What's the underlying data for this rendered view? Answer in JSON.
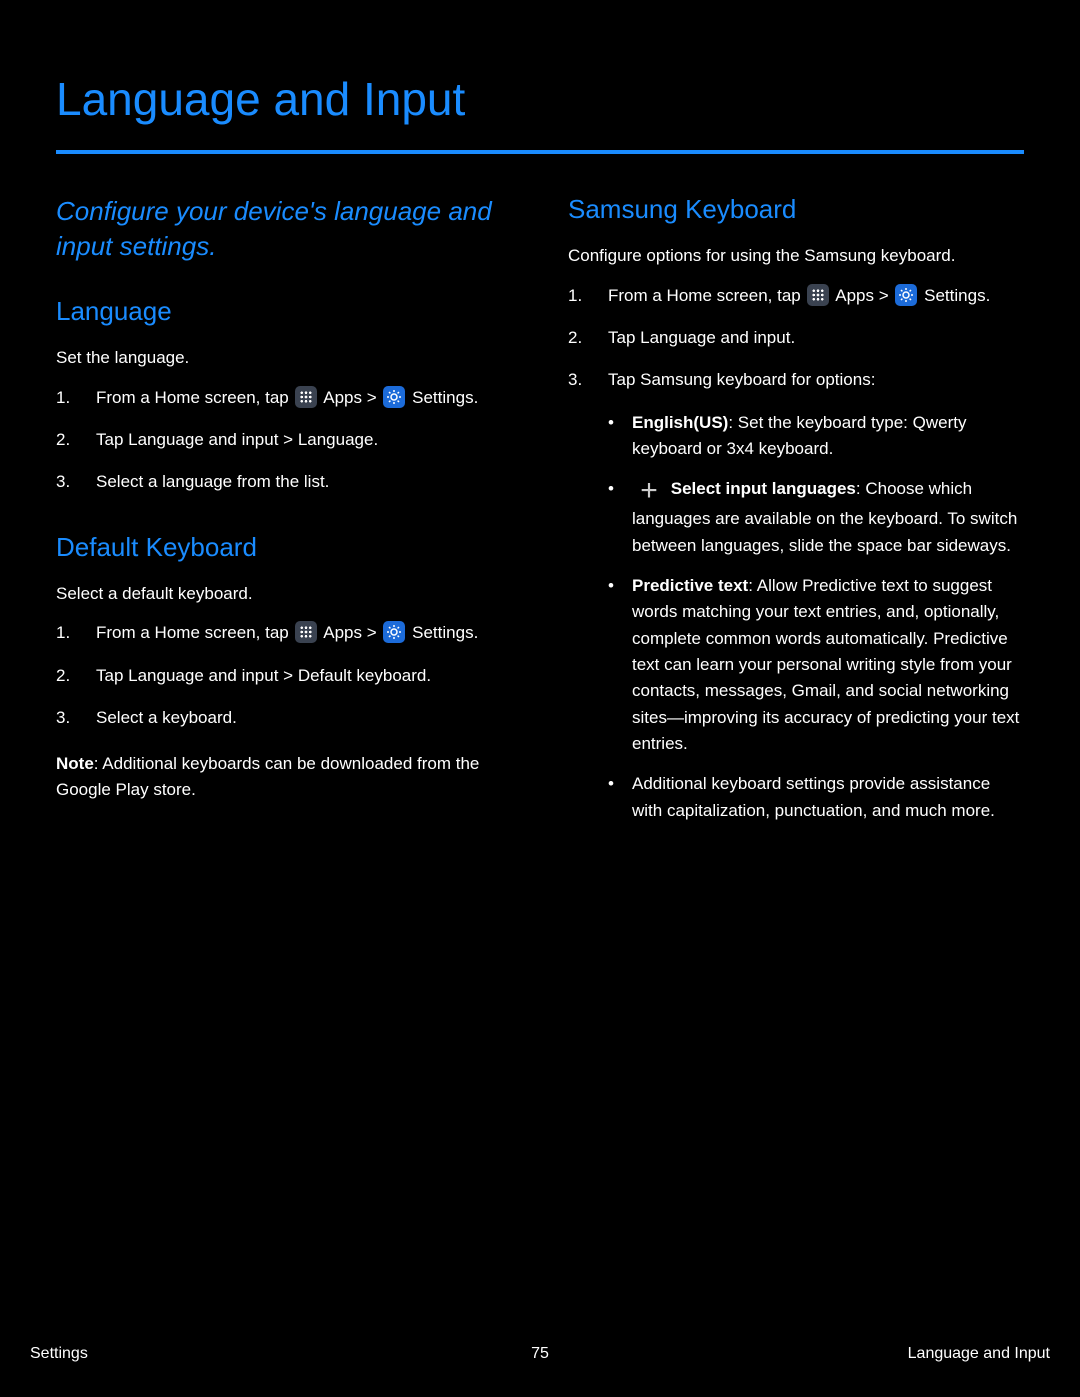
{
  "title": "Language and Input",
  "intro": "Configure your device's language and input settings.",
  "left": {
    "language": {
      "heading": "Language",
      "intro": "Set the language.",
      "step1_num": "1.",
      "step1_a": "From a Home screen, tap ",
      "apps_label": "Apps",
      "step1_b": " > ",
      "settings_label": "Settings",
      "step1_c": ".",
      "step2_num": "2.",
      "step2": "Tap Language and input > Language.",
      "step3_num": "3.",
      "step3": "Select a language from the list."
    },
    "default_kb": {
      "heading": "Default Keyboard",
      "intro": "Select a default keyboard.",
      "step1_num": "1.",
      "step1_a": "From a Home screen, tap ",
      "apps_label": "Apps",
      "step1_b": " > ",
      "settings_label": "Settings",
      "step1_c": ".",
      "step2_num": "2.",
      "step2": "Tap Language and input > Default keyboard.",
      "step3_num": "3.",
      "step3": "Select a keyboard."
    },
    "note": {
      "bold": "Note",
      "text": ": Additional keyboards can be downloaded from the Google Play store."
    }
  },
  "right": {
    "samsung_kb": {
      "heading": "Samsung Keyboard",
      "intro": "Configure options for using the Samsung keyboard.",
      "step1_num": "1.",
      "step1_a": "From a Home screen, tap ",
      "apps_label": "Apps",
      "step1_b": " > ",
      "settings_label": "Settings",
      "step1_c": ".",
      "step2_num": "2.",
      "step2": "Tap Language and input.",
      "step3_num": "3.",
      "step3": "Tap Samsung keyboard for options:",
      "bullet1_bold": "English(US)",
      "bullet1_text": ": Set the keyboard type: Qwerty keyboard or 3x4 keyboard.",
      "bullet2_a": "",
      "bullet2_bold": "Select input languages",
      "bullet2_text": ": Choose which languages are available on the keyboard. To switch between languages, slide the space bar sideways.",
      "bullet3_bold": "Predictive text",
      "bullet3_text": ": Allow Predictive text to suggest words matching your text entries, and, optionally, complete common words automatically. Predictive text can learn your personal writing style from your contacts, messages, Gmail, and social networking sites—improving its accuracy of predicting your text entries.",
      "bullet4": "Additional keyboard settings provide assistance with capitalization, punctuation, and much more."
    }
  },
  "footer": {
    "left": "Settings",
    "center": "75",
    "right": "Language and Input"
  }
}
